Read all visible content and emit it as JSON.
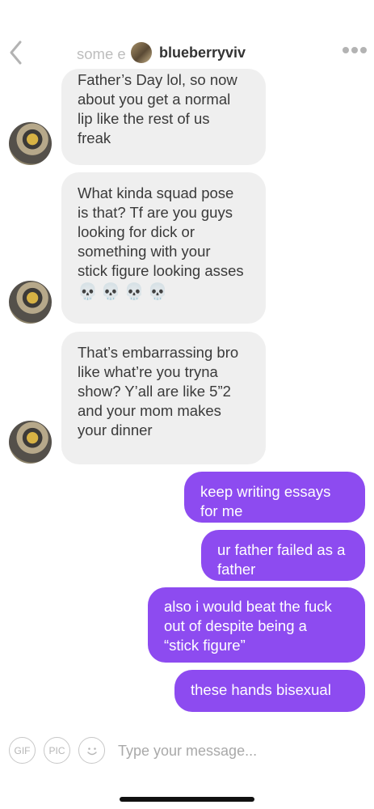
{
  "header": {
    "title": "blueberryviv",
    "back_icon": "chevron-left-icon",
    "more_icon": "more-dots-icon"
  },
  "messages": {
    "partial_top": "some e",
    "in1": [
      "Father’s Day lol, so now",
      "about you get a normal",
      "lip like the rest of us",
      "freak"
    ],
    "in2": [
      "What kinda squad pose",
      "is that? Tf are you guys",
      "looking for dick or",
      "something with your",
      "stick figure looking asses"
    ],
    "in2_emojis": "💀💀💀💀",
    "in3": [
      "That’s embarrassing bro",
      "like what’re you tryna",
      "show? Y’all are like 5”2",
      "and your mom makes",
      "your dinner"
    ],
    "out1": [
      "keep writing essays",
      "for me"
    ],
    "out2": [
      "ur father failed as a",
      "father"
    ],
    "out3": [
      "also i would beat the fuck",
      "out of despite being a",
      "“stick figure”"
    ],
    "out4": [
      "these hands bisexual"
    ]
  },
  "composer": {
    "gif_label": "GIF",
    "pic_label": "PIC",
    "emoji_icon": "smiley-icon",
    "placeholder": "Type your message..."
  },
  "colors": {
    "outgoing": "#8d4bf0",
    "incoming": "#efefef"
  }
}
